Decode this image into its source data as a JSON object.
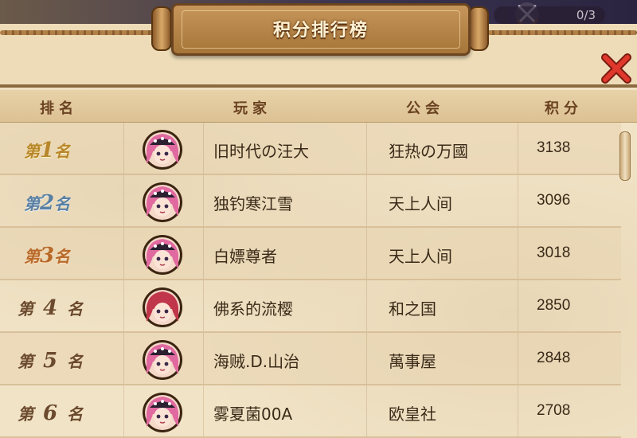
{
  "title": "积分排行榜",
  "top_counter": "0/3",
  "columns": {
    "rank": "排名",
    "player": "玩家",
    "guild": "公会",
    "score": "积分"
  },
  "rows": [
    {
      "rank_prefix": "第",
      "rank_num": "1",
      "rank_suffix": "名",
      "player": "旧时代の汪大",
      "guild": "狂热の万國",
      "score": "3138",
      "style": "gold"
    },
    {
      "rank_prefix": "第",
      "rank_num": "2",
      "rank_suffix": "名",
      "player": "独钓寒江雪",
      "guild": "天上人间",
      "score": "3096",
      "style": "silver"
    },
    {
      "rank_prefix": "第",
      "rank_num": "3",
      "rank_suffix": "名",
      "player": "白嫖尊者",
      "guild": "天上人间",
      "score": "3018",
      "style": "bronze"
    },
    {
      "rank_prefix": "第",
      "rank_num": "4",
      "rank_suffix": "名",
      "player": "佛系的流樱",
      "guild": "和之国",
      "score": "2850",
      "style": "plain"
    },
    {
      "rank_prefix": "第",
      "rank_num": "5",
      "rank_suffix": "名",
      "player": "海贼.D.山治",
      "guild": "萬事屋",
      "score": "2848",
      "style": "plain"
    },
    {
      "rank_prefix": "第",
      "rank_num": "6",
      "rank_suffix": "名",
      "player": "雾夏菌00A",
      "guild": "欧皇社",
      "score": "2708",
      "style": "plain"
    }
  ],
  "icons": {
    "close": "close-x-icon",
    "swords": "crossed-swords-icon",
    "avatar": "pink-hair-avatar-icon"
  },
  "colors": {
    "parchment": "#f1e3c6",
    "header_text": "#6a4222",
    "close_red": "#d8322a",
    "gold": "#b8862a",
    "silver": "#5a7fa0",
    "bronze": "#b86a2a"
  }
}
